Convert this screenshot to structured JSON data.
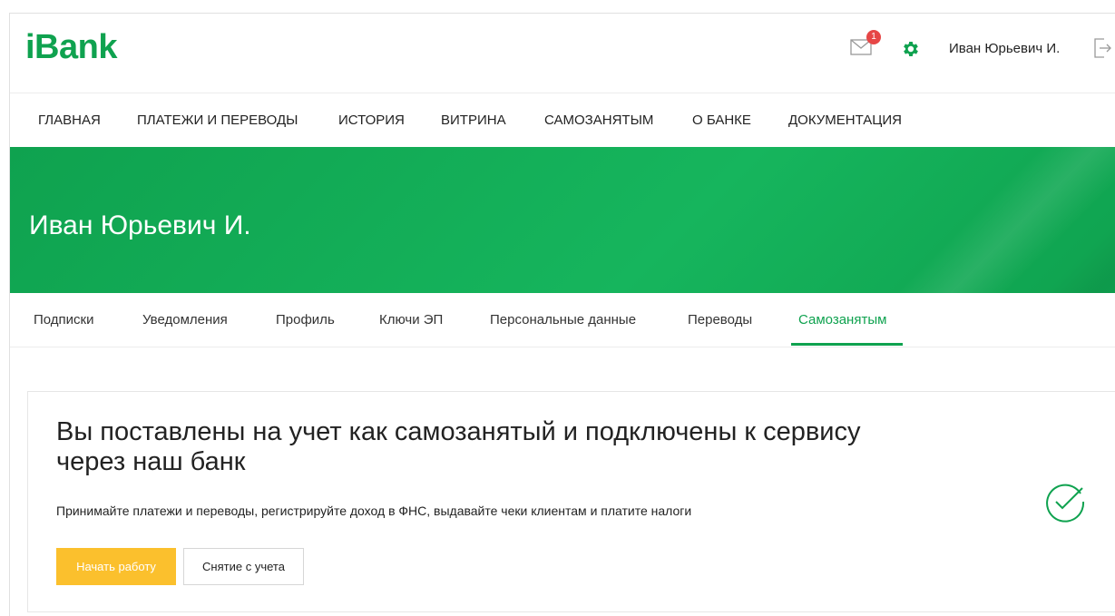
{
  "header": {
    "logo": "iBank",
    "mail_badge_count": "1",
    "username": "Иван Юрьевич И.",
    "icons": [
      "mail-icon",
      "gear-icon",
      "logout-icon"
    ]
  },
  "main_nav": {
    "items": [
      "ГЛАВНАЯ",
      "ПЛАТЕЖИ И ПЕРЕВОДЫ",
      "ИСТОРИЯ",
      "ВИТРИНА",
      "САМОЗАНЯТЫМ",
      "О БАНКЕ",
      "ДОКУМЕНТАЦИЯ"
    ]
  },
  "banner": {
    "title": "Иван Юрьевич И."
  },
  "sub_tabs": {
    "items": [
      "Подписки",
      "Уведомления",
      "Профиль",
      "Ключи ЭП",
      "Персональные данные",
      "Переводы",
      "Самозанятым"
    ],
    "active": "Самозанятым"
  },
  "card": {
    "title": "Вы поставлены на учет как самозанятый и подключены к сервису через наш банк",
    "description": "Принимайте платежи и переводы, регистрируйте доход в ФНС, выдавайте чеки клиентам и платите налоги",
    "primary_button": "Начать работу",
    "secondary_button": "Снятие с учета",
    "status_icon": "check-circle-icon"
  },
  "colors": {
    "brand_green": "#0fa24f",
    "accent_yellow": "#fbc02d",
    "badge_red": "#e64646"
  }
}
